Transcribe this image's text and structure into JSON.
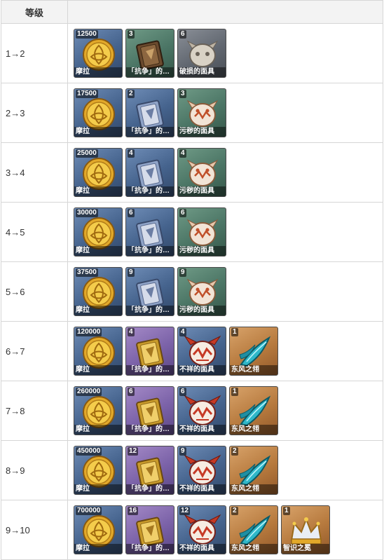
{
  "header": {
    "level_col": "等级",
    "material_col": ""
  },
  "rows": [
    {
      "level": "1→2",
      "items": [
        {
          "count": "12500",
          "name": "摩拉",
          "icon": "mora-coin-icon",
          "rarity": "r3"
        },
        {
          "count": "3",
          "name": "「抗争」的…",
          "icon": "teachings-book-icon",
          "rarity": "r2"
        },
        {
          "count": "6",
          "name": "破损的面具",
          "icon": "damaged-mask-icon",
          "rarity": "r1"
        }
      ]
    },
    {
      "level": "2→3",
      "items": [
        {
          "count": "17500",
          "name": "摩拉",
          "icon": "mora-coin-icon",
          "rarity": "r3"
        },
        {
          "count": "2",
          "name": "「抗争」的…",
          "icon": "guide-book-icon",
          "rarity": "r3"
        },
        {
          "count": "3",
          "name": "污秽的面具",
          "icon": "stained-mask-icon",
          "rarity": "r2"
        }
      ]
    },
    {
      "level": "3→4",
      "items": [
        {
          "count": "25000",
          "name": "摩拉",
          "icon": "mora-coin-icon",
          "rarity": "r3"
        },
        {
          "count": "4",
          "name": "「抗争」的…",
          "icon": "guide-book-icon",
          "rarity": "r3"
        },
        {
          "count": "4",
          "name": "污秽的面具",
          "icon": "stained-mask-icon",
          "rarity": "r2"
        }
      ]
    },
    {
      "level": "4→5",
      "items": [
        {
          "count": "30000",
          "name": "摩拉",
          "icon": "mora-coin-icon",
          "rarity": "r3"
        },
        {
          "count": "6",
          "name": "「抗争」的…",
          "icon": "guide-book-icon",
          "rarity": "r3"
        },
        {
          "count": "6",
          "name": "污秽的面具",
          "icon": "stained-mask-icon",
          "rarity": "r2"
        }
      ]
    },
    {
      "level": "5→6",
      "items": [
        {
          "count": "37500",
          "name": "摩拉",
          "icon": "mora-coin-icon",
          "rarity": "r3"
        },
        {
          "count": "9",
          "name": "「抗争」的…",
          "icon": "guide-book-icon",
          "rarity": "r3"
        },
        {
          "count": "9",
          "name": "污秽的面具",
          "icon": "stained-mask-icon",
          "rarity": "r2"
        }
      ]
    },
    {
      "level": "6→7",
      "items": [
        {
          "count": "120000",
          "name": "摩拉",
          "icon": "mora-coin-icon",
          "rarity": "r3"
        },
        {
          "count": "4",
          "name": "「抗争」的…",
          "icon": "philosophies-book-icon",
          "rarity": "r4"
        },
        {
          "count": "4",
          "name": "不祥的面具",
          "icon": "ominous-mask-icon",
          "rarity": "r3"
        },
        {
          "count": "1",
          "name": "东风之翎",
          "icon": "dvalin-plume-icon",
          "rarity": "r5"
        }
      ]
    },
    {
      "level": "7→8",
      "items": [
        {
          "count": "260000",
          "name": "摩拉",
          "icon": "mora-coin-icon",
          "rarity": "r3"
        },
        {
          "count": "6",
          "name": "「抗争」的…",
          "icon": "philosophies-book-icon",
          "rarity": "r4"
        },
        {
          "count": "6",
          "name": "不祥的面具",
          "icon": "ominous-mask-icon",
          "rarity": "r3"
        },
        {
          "count": "1",
          "name": "东风之翎",
          "icon": "dvalin-plume-icon",
          "rarity": "r5"
        }
      ]
    },
    {
      "level": "8→9",
      "items": [
        {
          "count": "450000",
          "name": "摩拉",
          "icon": "mora-coin-icon",
          "rarity": "r3"
        },
        {
          "count": "12",
          "name": "「抗争」的…",
          "icon": "philosophies-book-icon",
          "rarity": "r4"
        },
        {
          "count": "9",
          "name": "不祥的面具",
          "icon": "ominous-mask-icon",
          "rarity": "r3"
        },
        {
          "count": "2",
          "name": "东风之翎",
          "icon": "dvalin-plume-icon",
          "rarity": "r5"
        }
      ]
    },
    {
      "level": "9→10",
      "items": [
        {
          "count": "700000",
          "name": "摩拉",
          "icon": "mora-coin-icon",
          "rarity": "r3"
        },
        {
          "count": "16",
          "name": "「抗争」的…",
          "icon": "philosophies-book-icon",
          "rarity": "r4"
        },
        {
          "count": "12",
          "name": "不祥的面具",
          "icon": "ominous-mask-icon",
          "rarity": "r3"
        },
        {
          "count": "2",
          "name": "东风之翎",
          "icon": "dvalin-plume-icon",
          "rarity": "r5"
        },
        {
          "count": "1",
          "name": "智识之冕",
          "icon": "crown-of-insight-icon",
          "rarity": "r5"
        }
      ]
    }
  ]
}
